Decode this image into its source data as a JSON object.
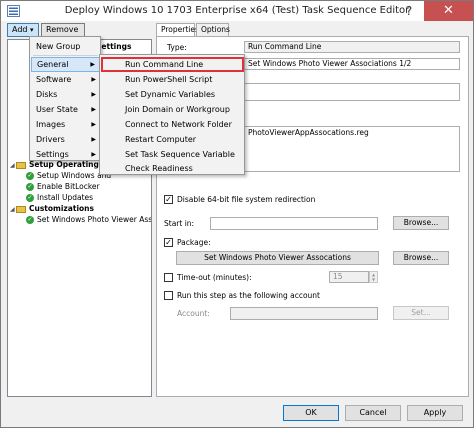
{
  "window": {
    "title": "Deploy Windows 10 1703 Enterprise x64 (Test) Task Sequence Editor",
    "help_glyph": "?",
    "close_glyph": "✕"
  },
  "toolbar": {
    "add_label": "Add",
    "add_arrow": "▾",
    "remove_label": "Remove"
  },
  "tree": {
    "partial_header": "Settings",
    "groups": [
      {
        "label": "Setup Operating Sy",
        "items": [
          "Setup Windows and",
          "Enable BitLocker",
          "Install Updates"
        ]
      },
      {
        "label": "Customizations",
        "items": [
          "Set Windows Photo Viewer Assoc"
        ]
      }
    ]
  },
  "add_menu": {
    "items": [
      {
        "label": "New Group",
        "submenu": false
      },
      {
        "label": "General",
        "submenu": true
      },
      {
        "label": "Software",
        "submenu": true
      },
      {
        "label": "Disks",
        "submenu": true
      },
      {
        "label": "User State",
        "submenu": true
      },
      {
        "label": "Images",
        "submenu": true
      },
      {
        "label": "Drivers",
        "submenu": true
      },
      {
        "label": "Settings",
        "submenu": true
      }
    ],
    "submenu_arrow": "▶"
  },
  "general_menu": {
    "items": [
      "Run Command Line",
      "Run PowerShell Script",
      "Set Dynamic Variables",
      "Join Domain or Workgroup",
      "Connect to Network Folder",
      "Restart Computer",
      "Set Task Sequence Variable",
      "Check Readiness"
    ]
  },
  "tabs": {
    "properties": "Properties",
    "options": "Options"
  },
  "properties": {
    "type_label": "Type:",
    "type_value": "Run Command Line",
    "name_value": "Set Windows Photo Viewer Associations 1/2",
    "command_value": "PhotoViewerAppAssocations.reg",
    "disable_64bit_label": "Disable 64-bit file system redirection",
    "start_in_label": "Start in:",
    "start_in_value": "",
    "browse_label": "Browse...",
    "package_label": "Package:",
    "package_value": "Set Windows Photo Viewer Assocations",
    "timeout_label": "Time-out (minutes):",
    "timeout_value": "15",
    "run_as_label": "Run this step as the following account",
    "account_label": "Account:",
    "account_value": "",
    "set_label": "Set...",
    "check_glyph": "✓",
    "spin_up": "▲",
    "spin_down": "▼"
  },
  "dialog": {
    "ok": "OK",
    "cancel": "Cancel",
    "apply": "Apply"
  },
  "colors": {
    "highlight_border": "#e0303a",
    "hover_bg": "#d5e7f8",
    "success": "#2f9e3b"
  }
}
